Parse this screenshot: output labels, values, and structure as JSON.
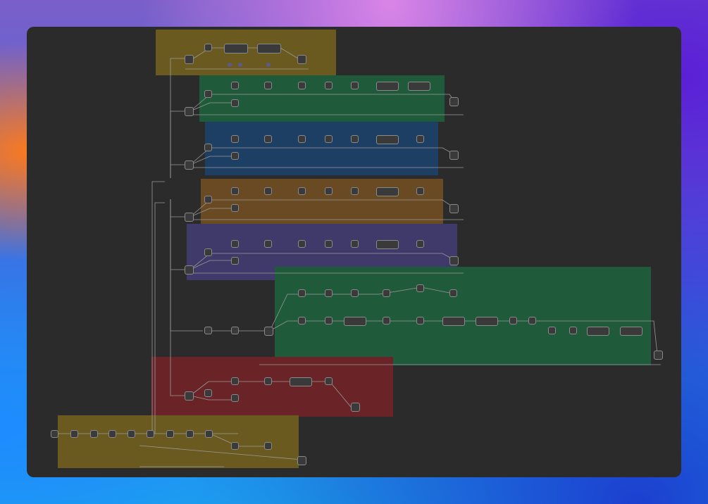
{
  "window": {
    "title": ""
  },
  "colors": {
    "canvas_bg": "#2b2b2b",
    "group_yellow": "#6b5a1f",
    "group_green": "#1f5a3a",
    "group_blue": "#1d3f63",
    "group_orange": "#6a4a22",
    "group_purple": "#3f3a6a",
    "group_green2": "#1f5a3a",
    "group_red": "#6a2428",
    "group_yellow2": "#6b5a1f",
    "node_border": "#8a8a8a",
    "connector": "#9a9a9a"
  },
  "groups": [
    {
      "id": "g1",
      "title": "",
      "color": "#6b5a1f"
    },
    {
      "id": "g2",
      "title": "",
      "color": "#1f5a3a"
    },
    {
      "id": "g3",
      "title": "",
      "color": "#1d3f63"
    },
    {
      "id": "g4",
      "title": "",
      "color": "#6a4a22"
    },
    {
      "id": "g5",
      "title": "",
      "color": "#3f3a6a"
    },
    {
      "id": "g6",
      "title": "",
      "color": "#1f5a3a"
    },
    {
      "id": "g7",
      "title": "",
      "color": "#6a2428"
    },
    {
      "id": "g8",
      "title": "",
      "color": "#6b5a1f"
    }
  ],
  "icons": [
    "workflow-node-icon",
    "ai-agent-icon",
    "trigger-icon",
    "filter-icon",
    "loop-icon",
    "merge-icon"
  ]
}
